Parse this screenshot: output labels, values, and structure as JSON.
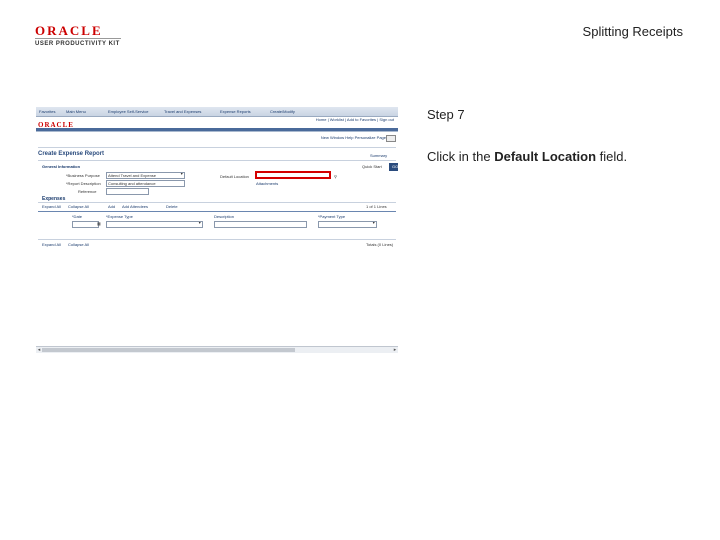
{
  "logo": {
    "brand": "ORACLE",
    "product": "USER PRODUCTIVITY KIT"
  },
  "slide_title": "Splitting Receipts",
  "step": {
    "label": "Step 7",
    "text_prefix": "Click in the ",
    "bold_term": "Default Location",
    "text_suffix": " field."
  },
  "screenshot": {
    "topnav": [
      "Favorites",
      "Main Menu",
      "Employee Self-Service",
      "Travel and Expenses",
      "Expense Reports",
      "Create/Modify"
    ],
    "brand": "ORACLE",
    "subnav": [
      "Home",
      "Worklist",
      "Add to Favorites",
      "Sign out"
    ],
    "personalize": "New Window  Help  Personalize Page",
    "page_title": "Create Expense Report",
    "summary_link": "Summary",
    "general_info": "General Information",
    "quick_start": "Quick Start",
    "go_label": "GO",
    "business_purpose_label": "*Business Purpose",
    "business_purpose_value": "Attend Travel and Expense",
    "report_description_label": "*Report Description",
    "report_description_value": "Consulting and attendance",
    "reference_label": "Reference",
    "default_location_label": "Default Location",
    "attachments": "Attachments",
    "expenses_header": "Expenses",
    "expenses_links": [
      "Expand All",
      "Collapse All",
      "Add",
      "Add Attendees",
      "Delete"
    ],
    "rows_label": "1 of 1 Lines",
    "columns": [
      "*Date",
      "*Expense Type",
      "Description",
      "*Payment Type"
    ],
    "footer_links": [
      "Expand All",
      "Collapse All"
    ],
    "footer_right": "Totals (0 Lines)"
  }
}
